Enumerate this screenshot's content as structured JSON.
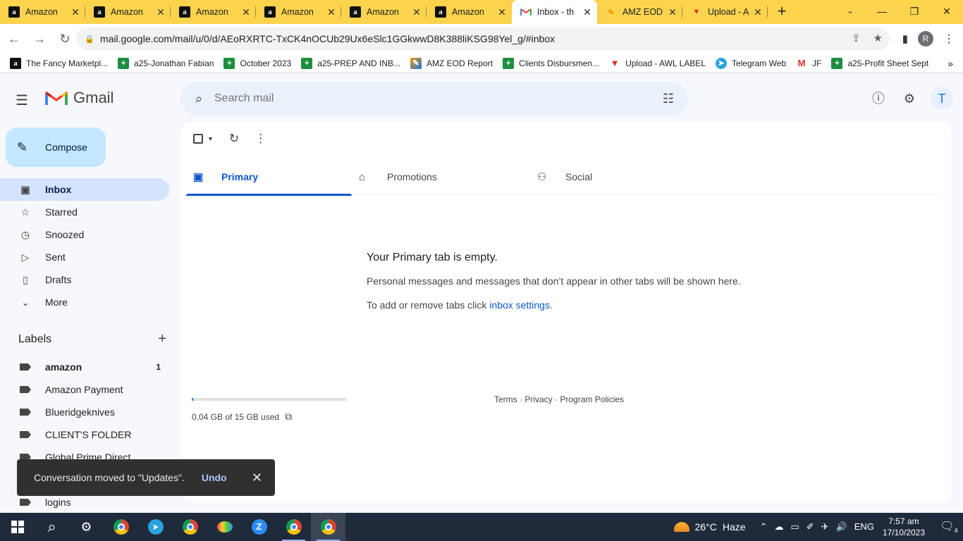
{
  "browser": {
    "tabs": [
      {
        "title": "Amazon",
        "icon": "amazon-icon",
        "active": false
      },
      {
        "title": "Amazon",
        "icon": "amazon-icon",
        "active": false
      },
      {
        "title": "Amazon",
        "icon": "amazon-icon",
        "active": false
      },
      {
        "title": "Amazon",
        "icon": "amazon-icon",
        "active": false
      },
      {
        "title": "Amazon",
        "icon": "amazon-icon",
        "active": false
      },
      {
        "title": "Amazon",
        "icon": "amazon-icon",
        "active": false
      },
      {
        "title": "Inbox - th",
        "icon": "gmail-icon",
        "active": true
      },
      {
        "title": "AMZ EOD",
        "icon": "pencil-icon",
        "active": false
      },
      {
        "title": "Upload - A",
        "icon": "awl-icon",
        "active": false
      }
    ],
    "url": "mail.google.com/mail/u/0/d/AEoRXRTC-TxCK4nOCUb29Ux6eSlc1GGkwwD8K388liKSG98Yel_g/#inbox",
    "profile_initial": "R",
    "bookmarks": [
      {
        "label": "The Fancy Marketpl...",
        "icon": "amazon-icon"
      },
      {
        "label": "a25-Jonathan Fabian",
        "icon": "sheets-icon"
      },
      {
        "label": "October 2023",
        "icon": "sheets-icon"
      },
      {
        "label": "a25-PREP AND INB...",
        "icon": "sheets-icon"
      },
      {
        "label": "AMZ EOD Report",
        "icon": "pencil-icon"
      },
      {
        "label": "Clients Disbursmen...",
        "icon": "sheets-icon"
      },
      {
        "label": "Upload - AWL LABEL",
        "icon": "awl-icon"
      },
      {
        "label": "Telegram Web",
        "icon": "telegram-icon"
      },
      {
        "label": "JF",
        "icon": "gmail-icon"
      },
      {
        "label": "a25-Profit Sheet Sept",
        "icon": "sheets-icon"
      }
    ]
  },
  "gmail": {
    "brand": "Gmail",
    "search_placeholder": "Search mail",
    "account_initial": "T",
    "compose_label": "Compose",
    "nav": [
      {
        "label": "Inbox",
        "icon": "inbox-icon",
        "active": true
      },
      {
        "label": "Starred",
        "icon": "star-icon",
        "active": false
      },
      {
        "label": "Snoozed",
        "icon": "clock-icon",
        "active": false
      },
      {
        "label": "Sent",
        "icon": "send-icon",
        "active": false
      },
      {
        "label": "Drafts",
        "icon": "draft-icon",
        "active": false
      },
      {
        "label": "More",
        "icon": "chevron-down-icon",
        "active": false
      }
    ],
    "labels_title": "Labels",
    "labels": [
      {
        "label": "amazon",
        "count": "1",
        "bold": true
      },
      {
        "label": "Amazon Payment",
        "count": "",
        "bold": false
      },
      {
        "label": "Blueridgeknives",
        "count": "",
        "bold": false
      },
      {
        "label": "CLIENT'S FOLDER",
        "count": "",
        "bold": false
      },
      {
        "label": "Global Prime Direct",
        "count": "",
        "bold": false
      },
      {
        "label": "",
        "count": "",
        "bold": false
      },
      {
        "label": "logins",
        "count": "",
        "bold": false
      }
    ],
    "tabs": [
      {
        "label": "Primary",
        "icon": "inbox-tab-icon",
        "active": true
      },
      {
        "label": "Promotions",
        "icon": "tag-icon",
        "active": false
      },
      {
        "label": "Social",
        "icon": "people-icon",
        "active": false
      }
    ],
    "empty": {
      "title": "Your Primary tab is empty.",
      "line1": "Personal messages and messages that don’t appear in other tabs will be shown here.",
      "line2_prefix": "To add or remove tabs click ",
      "line2_link": "inbox settings",
      "line2_suffix": "."
    },
    "storage": {
      "text": "0.04 GB of 15 GB used",
      "fraction": 0.003
    },
    "footer": {
      "terms": "Terms",
      "privacy": "Privacy",
      "policies": "Program Policies",
      "sep": " · "
    },
    "snackbar": {
      "message": "Conversation moved to \"Updates\".",
      "action": "Undo"
    }
  },
  "taskbar": {
    "weather": {
      "temp": "26°C",
      "condition": "Haze"
    },
    "language": "ENG",
    "time": "7:57 am",
    "date": "17/10/2023",
    "notifications": "4"
  }
}
